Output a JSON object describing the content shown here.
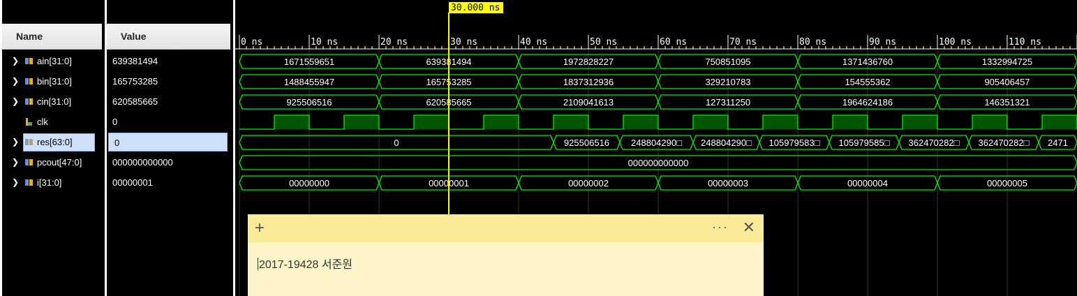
{
  "columns": {
    "name": "Name",
    "value": "Value"
  },
  "signals": [
    {
      "name": "ain[31:0]",
      "value": "639381494",
      "expandable": true,
      "icon": "bus-icon",
      "selected": false
    },
    {
      "name": "bin[31:0]",
      "value": "165753285",
      "expandable": true,
      "icon": "bus-icon",
      "selected": false
    },
    {
      "name": "cin[31:0]",
      "value": "620585665",
      "expandable": true,
      "icon": "bus-icon",
      "selected": false
    },
    {
      "name": "clk",
      "value": "0",
      "expandable": false,
      "icon": "bit-icon",
      "selected": false
    },
    {
      "name": "res[63:0]",
      "value": "0",
      "expandable": true,
      "icon": "bus-icon",
      "selected": true
    },
    {
      "name": "pcout[47:0]",
      "value": "000000000000",
      "expandable": true,
      "icon": "bus-icon",
      "selected": false
    },
    {
      "name": "i[31:0]",
      "value": "00000001",
      "expandable": true,
      "icon": "bus-icon",
      "selected": false
    }
  ],
  "cursor": {
    "time_ns": 30,
    "label": "30.000 ns",
    "color": "#ffff00"
  },
  "time_axis": {
    "start_ns": 0,
    "step_ns": 10,
    "labels": [
      "0 ns",
      "10 ns",
      "20 ns",
      "30 ns",
      "40 ns",
      "50 ns",
      "60 ns",
      "70 ns",
      "80 ns",
      "90 ns",
      "100 ns",
      "110 ns"
    ]
  },
  "waves": {
    "ain": [
      {
        "t0": 0,
        "t1": 20,
        "v": "1671559651"
      },
      {
        "t0": 20,
        "t1": 40,
        "v": "639381494"
      },
      {
        "t0": 40,
        "t1": 60,
        "v": "1972828227"
      },
      {
        "t0": 60,
        "t1": 80,
        "v": "750851095"
      },
      {
        "t0": 80,
        "t1": 100,
        "v": "1371436760"
      },
      {
        "t0": 100,
        "t1": 120,
        "v": "1332994725"
      }
    ],
    "bin": [
      {
        "t0": 0,
        "t1": 20,
        "v": "1488455947"
      },
      {
        "t0": 20,
        "t1": 40,
        "v": "165753285"
      },
      {
        "t0": 40,
        "t1": 60,
        "v": "1837312936"
      },
      {
        "t0": 60,
        "t1": 80,
        "v": "329210783"
      },
      {
        "t0": 80,
        "t1": 100,
        "v": "154555362"
      },
      {
        "t0": 100,
        "t1": 120,
        "v": "905406457"
      }
    ],
    "cin": [
      {
        "t0": 0,
        "t1": 20,
        "v": "925506516"
      },
      {
        "t0": 20,
        "t1": 40,
        "v": "620585665"
      },
      {
        "t0": 40,
        "t1": 60,
        "v": "2109041613"
      },
      {
        "t0": 60,
        "t1": 80,
        "v": "127311250"
      },
      {
        "t0": 80,
        "t1": 100,
        "v": "1964624186"
      },
      {
        "t0": 100,
        "t1": 120,
        "v": "146351321"
      }
    ],
    "clk": {
      "period_ns": 10,
      "first_high_ns": 5
    },
    "res": [
      {
        "t0": 0,
        "t1": 45,
        "v": "0"
      },
      {
        "t0": 45,
        "t1": 54.5,
        "v": "925506516"
      },
      {
        "t0": 54.5,
        "t1": 65,
        "v": "248804290□"
      },
      {
        "t0": 65,
        "t1": 74.5,
        "v": "248804290□"
      },
      {
        "t0": 74.5,
        "t1": 84.5,
        "v": "105979583□"
      },
      {
        "t0": 84.5,
        "t1": 94.5,
        "v": "105979585□"
      },
      {
        "t0": 94.5,
        "t1": 104.5,
        "v": "362470282□"
      },
      {
        "t0": 104.5,
        "t1": 114.5,
        "v": "362470282□"
      },
      {
        "t0": 114.5,
        "t1": 120,
        "v": "2471"
      }
    ],
    "pcout": [
      {
        "t0": 0,
        "t1": 120,
        "v": "000000000000"
      }
    ],
    "i": [
      {
        "t0": 0,
        "t1": 20,
        "v": "00000000"
      },
      {
        "t0": 20,
        "t1": 40,
        "v": "00000001"
      },
      {
        "t0": 40,
        "t1": 60,
        "v": "00000002"
      },
      {
        "t0": 60,
        "t1": 80,
        "v": "00000003"
      },
      {
        "t0": 80,
        "t1": 100,
        "v": "00000004"
      },
      {
        "t0": 100,
        "t1": 120,
        "v": "00000005"
      }
    ]
  },
  "colors": {
    "wave": "#00ee00",
    "clk_fill": "#005500",
    "grid": "#333333",
    "axis_text": "#ffffff",
    "background": "#000000"
  },
  "sticky_note": {
    "text": "2017-19428 서준원",
    "add_icon": "plus-icon",
    "menu_icon": "more-icon",
    "close_icon": "close-icon"
  }
}
